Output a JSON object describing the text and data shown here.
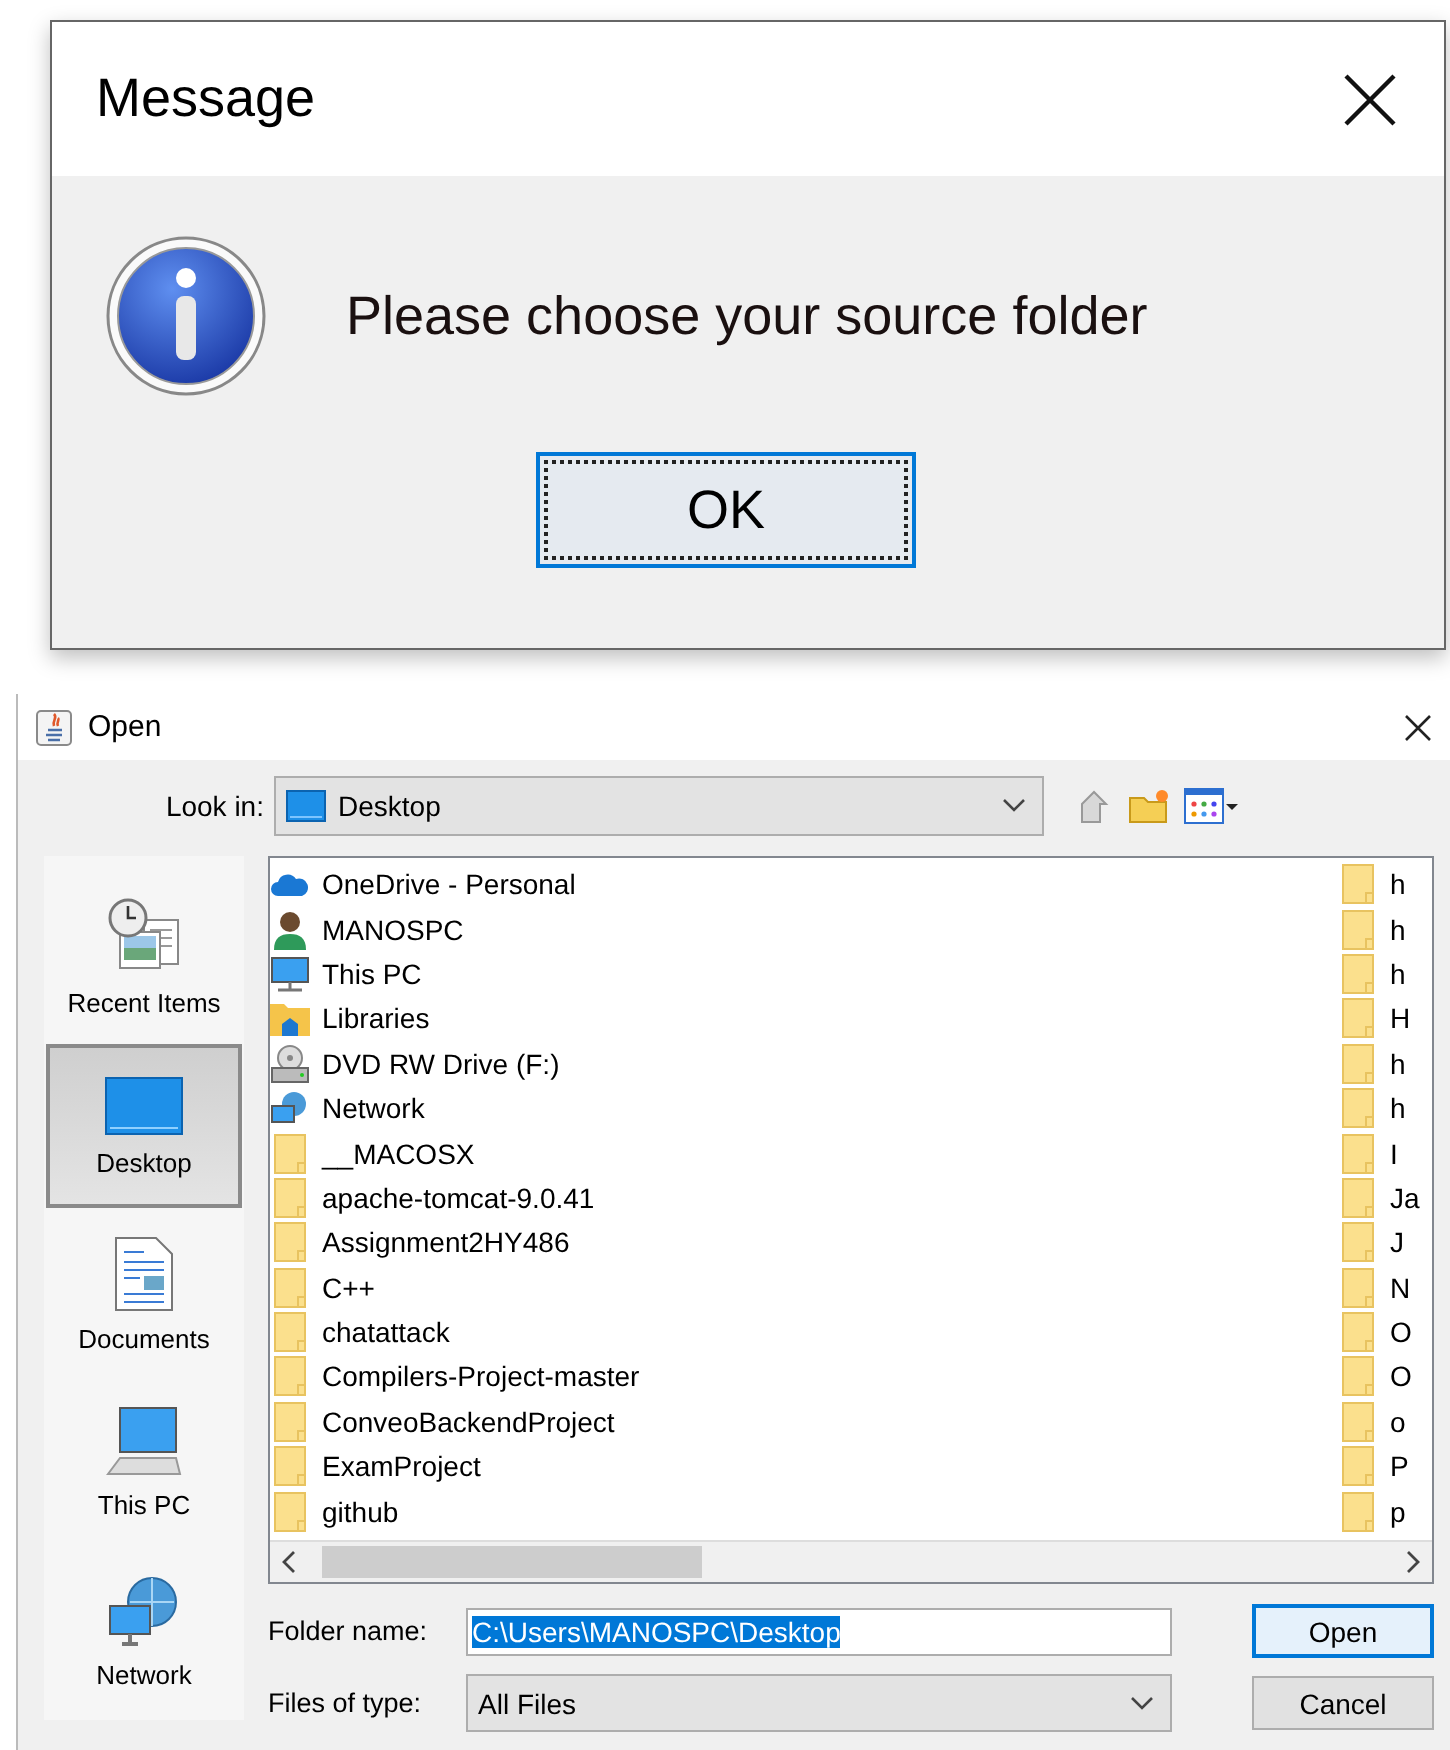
{
  "message_dialog": {
    "title": "Message",
    "text": "Please choose your source folder",
    "buttons": [
      {
        "label": "OK",
        "focused": true
      }
    ]
  },
  "open_dialog": {
    "title": "Open",
    "look_in": {
      "label": "Look in:",
      "value": "Desktop"
    },
    "places": [
      {
        "label": "Recent Items",
        "kind": "recent",
        "selected": false
      },
      {
        "label": "Desktop",
        "kind": "desktop",
        "selected": true
      },
      {
        "label": "Documents",
        "kind": "documents",
        "selected": false
      },
      {
        "label": "This PC",
        "kind": "computer",
        "selected": false
      },
      {
        "label": "Network",
        "kind": "network",
        "selected": false
      }
    ],
    "files": [
      {
        "name": "OneDrive - Personal",
        "kind": "cloud"
      },
      {
        "name": "MANOSPC",
        "kind": "user"
      },
      {
        "name": "This PC",
        "kind": "computer"
      },
      {
        "name": "Libraries",
        "kind": "libraries"
      },
      {
        "name": "DVD RW Drive (F:)",
        "kind": "dvd"
      },
      {
        "name": "Network",
        "kind": "network"
      },
      {
        "name": "__MACOSX",
        "kind": "folder"
      },
      {
        "name": "apache-tomcat-9.0.41",
        "kind": "folder"
      },
      {
        "name": "Assignment2HY486",
        "kind": "folder"
      },
      {
        "name": "C++",
        "kind": "folder"
      },
      {
        "name": "chatattack",
        "kind": "folder"
      },
      {
        "name": "Compilers-Project-master",
        "kind": "folder"
      },
      {
        "name": "ConveoBackendProject",
        "kind": "folder"
      },
      {
        "name": "ExamProject",
        "kind": "folder"
      },
      {
        "name": "github",
        "kind": "folder"
      }
    ],
    "files_column_2": [
      {
        "name": "h",
        "kind": "folder"
      },
      {
        "name": "h",
        "kind": "folder"
      },
      {
        "name": "h",
        "kind": "folder"
      },
      {
        "name": "H",
        "kind": "folder"
      },
      {
        "name": "h",
        "kind": "folder"
      },
      {
        "name": "h",
        "kind": "folder"
      },
      {
        "name": "I",
        "kind": "folder"
      },
      {
        "name": "Ja",
        "kind": "folder"
      },
      {
        "name": "J",
        "kind": "folder"
      },
      {
        "name": "N",
        "kind": "folder"
      },
      {
        "name": "O",
        "kind": "folder"
      },
      {
        "name": "O",
        "kind": "folder"
      },
      {
        "name": "o",
        "kind": "folder"
      },
      {
        "name": "P",
        "kind": "folder"
      },
      {
        "name": "p",
        "kind": "folder"
      }
    ],
    "folder_name": {
      "label": "Folder name:",
      "value": "C:\\Users\\MANOSPC\\Desktop",
      "selected": true
    },
    "files_of_type": {
      "label": "Files of type:",
      "value": "All Files"
    },
    "buttons": [
      {
        "label": "Open",
        "focused": true
      },
      {
        "label": "Cancel",
        "focused": false
      }
    ]
  }
}
